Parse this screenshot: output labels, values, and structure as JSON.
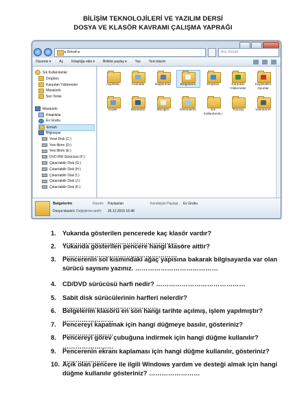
{
  "title_line1": "BİLİŞİM TEKNOLOJİLERİ VE YAZILIM DERSİ",
  "title_line2": "DOSYA VE KLASÖR KAVRAMI ÇALIŞMA YAPRAĞI",
  "window": {
    "breadcrumb": "▸ Emrah ▸",
    "search_placeholder": "Ara: Emrah",
    "toolbar": [
      "Düzenle ▾",
      "Aç",
      "Kitaplığa ekle ▾",
      "Birlikte paylaş ▾",
      "Yaz",
      "Yeni klasör"
    ],
    "nav_items": [
      {
        "label": "Sık Kullanılanlar",
        "icon": "star",
        "indent": 0
      },
      {
        "label": "Dropbox",
        "icon": "folder",
        "indent": 1
      },
      {
        "label": "Karşıdan Yüklemeler",
        "icon": "folder",
        "indent": 1
      },
      {
        "label": "Masaüstü",
        "icon": "folder",
        "indent": 1
      },
      {
        "label": "Son Yerler",
        "icon": "folder",
        "indent": 1
      },
      {
        "label": "",
        "icon": "",
        "indent": 0
      },
      {
        "label": "Masaüstü",
        "icon": "pc",
        "indent": 0
      },
      {
        "label": "Kitaplıklar",
        "icon": "lib",
        "indent": 1
      },
      {
        "label": "Ev Grubu",
        "icon": "grp",
        "indent": 1
      },
      {
        "label": "Emrah",
        "icon": "folder",
        "indent": 1,
        "selected": true
      },
      {
        "label": "Bilgisayar",
        "icon": "pc",
        "indent": 1
      },
      {
        "label": "Yerel Disk (C:)",
        "icon": "disk",
        "indent": 2
      },
      {
        "label": "Yeni Birim (D:)",
        "icon": "disk",
        "indent": 2
      },
      {
        "label": "Yeni Birim (E:)",
        "icon": "disk",
        "indent": 2
      },
      {
        "label": "DVD RW Sürücüsü (F:)",
        "icon": "disk",
        "indent": 2
      },
      {
        "label": "Çıkarılabilir Disk (G:)",
        "icon": "disk",
        "indent": 2
      },
      {
        "label": "Çıkarılabilir Disk (H:)",
        "icon": "disk",
        "indent": 2
      },
      {
        "label": "Çıkarılabilir Disk (I:)",
        "icon": "disk",
        "indent": 2
      },
      {
        "label": "Çıkarılabilir Disk (J:)",
        "icon": "disk",
        "indent": 2
      },
      {
        "label": "Çıkarılabilir Disk (K:)",
        "icon": "disk",
        "indent": 2
      }
    ],
    "folders": [
      {
        "label": "AppData",
        "badge": ""
      },
      {
        "label": "Aramalar",
        "badge": "#7ab0e6"
      },
      {
        "label": "Bağlantılar",
        "badge": "#4a7fc7"
      },
      {
        "label": "Belgelerim",
        "badge": "#f4f6f9",
        "selected": true
      },
      {
        "label": "Dropbox",
        "badge": "#3e8ae0"
      },
      {
        "label": "Karşıdan Yüklemeler",
        "badge": "#3d8d2f"
      },
      {
        "label": "Kaydedilen Oyunlar",
        "badge": "#c0392b"
      },
      {
        "label": "Kişiler",
        "badge": "#6b9bd2"
      },
      {
        "label": "Masaüstü",
        "badge": "#2d5e9e"
      },
      {
        "label": "Müziğim",
        "badge": "#e8eef5"
      },
      {
        "label": "Resimlerim",
        "badge": "#a3c9e8"
      },
      {
        "label": "Sık Kullanılanla r",
        "badge": "#f2c24c"
      },
      {
        "label": "Tracing",
        "badge": ""
      },
      {
        "label": "Videolarım",
        "badge": "#555a66"
      }
    ],
    "details": {
      "name": "Belgelerim",
      "state_label": "Durum:",
      "state_value": "Paylaşılan",
      "shared_label": "Kendisiyle Paylaşl...",
      "shared_value": "Ev Grubu",
      "type": "Dosya klasörü",
      "date_label": "Değiştirme tarihi:",
      "date_value": "26.12.2015 16:48"
    }
  },
  "questions": [
    {
      "num": "1.",
      "text": "Yukarıda gösterilen pencerede kaç klasör vardır? ………………………………………………"
    },
    {
      "num": "2.",
      "text": "Yukarıda gösterilen pencere hangi klasöre aittir? ………………………………………………"
    },
    {
      "num": "3.",
      "text": "Pencerenin sol kısmındaki ağaç yapısına bakarak bilgisayarda var olan sürücü sayısını yazınız. …………………………………"
    },
    {
      "num": "4.",
      "text": "CD/DVD sürücüsü harfi nedir? ……………………………………"
    },
    {
      "num": "5.",
      "text": "Sabit disk sürücülerinin harfleri nelerdir? ………………………………………"
    },
    {
      "num": "6.",
      "text": "Belgelerim klasörü en son hangi tarihte açılmış, işlem yapılmıştır? ……………………"
    },
    {
      "num": "7.",
      "text": "Pencereyi kapatmak için hangi düğmeye basılır, gösteriniz? ……………………"
    },
    {
      "num": "8.",
      "text": "Pencereyi görev çubuğuna indirmek için hangi düğme kullanılır? ……………………"
    },
    {
      "num": "9.",
      "text": "Pencerenin ekranı kaplaması için hangi düğme kullanılır, gösteriniz? …………………"
    },
    {
      "num": "10.",
      "text": "Açık olan pencere ile ilgili Windows yardım ve desteği almak için hangi düğme kullanılır gösteriniz? ……………………"
    }
  ]
}
